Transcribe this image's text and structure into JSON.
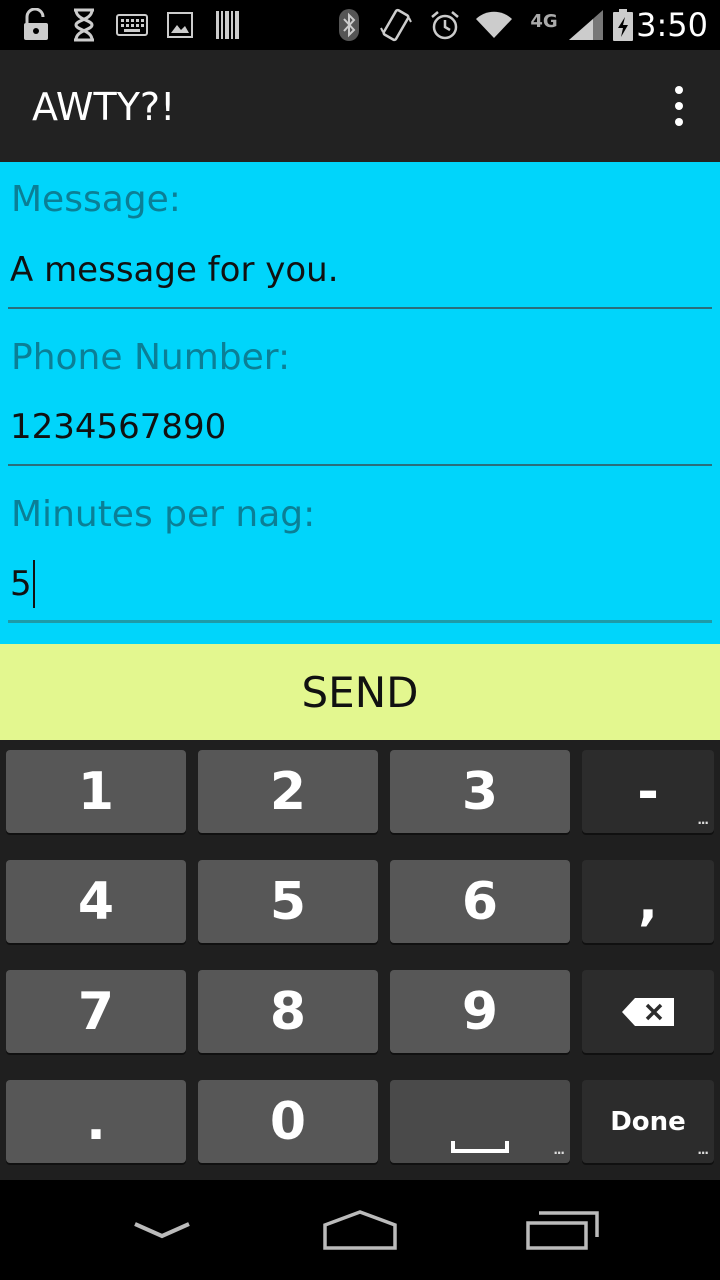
{
  "status_bar": {
    "time": "3:50",
    "network_label": "4G",
    "icons": [
      "unlock-icon",
      "hourglass-icon",
      "keyboard-icon",
      "image-icon",
      "barcode-icon",
      "bluetooth-icon",
      "vibrate-icon",
      "alarm-icon",
      "wifi-icon",
      "signal-icon",
      "battery-charging-icon"
    ]
  },
  "action_bar": {
    "title": "AWTY?!",
    "overflow_icon": "more-vert-icon"
  },
  "form": {
    "message_label": "Message:",
    "message_value": "A message for you.",
    "phone_label": "Phone Number:",
    "phone_value": "1234567890",
    "minutes_label": "Minutes per nag:",
    "minutes_value": "5"
  },
  "send_button": {
    "label": "SEND"
  },
  "keyboard": {
    "rows": [
      [
        "1",
        "2",
        "3",
        "-"
      ],
      [
        "4",
        "5",
        "6",
        ","
      ],
      [
        "7",
        "8",
        "9",
        "backspace"
      ],
      [
        ".",
        "0",
        "space",
        "Done"
      ]
    ],
    "done_label": "Done"
  },
  "colors": {
    "form_background": "#00d5fb",
    "send_background": "#e3f78f",
    "label_color": "#0b7f96",
    "action_bar": "#222222"
  },
  "nav_bar": {
    "icons": [
      "back-icon",
      "home-icon",
      "recents-icon"
    ]
  }
}
